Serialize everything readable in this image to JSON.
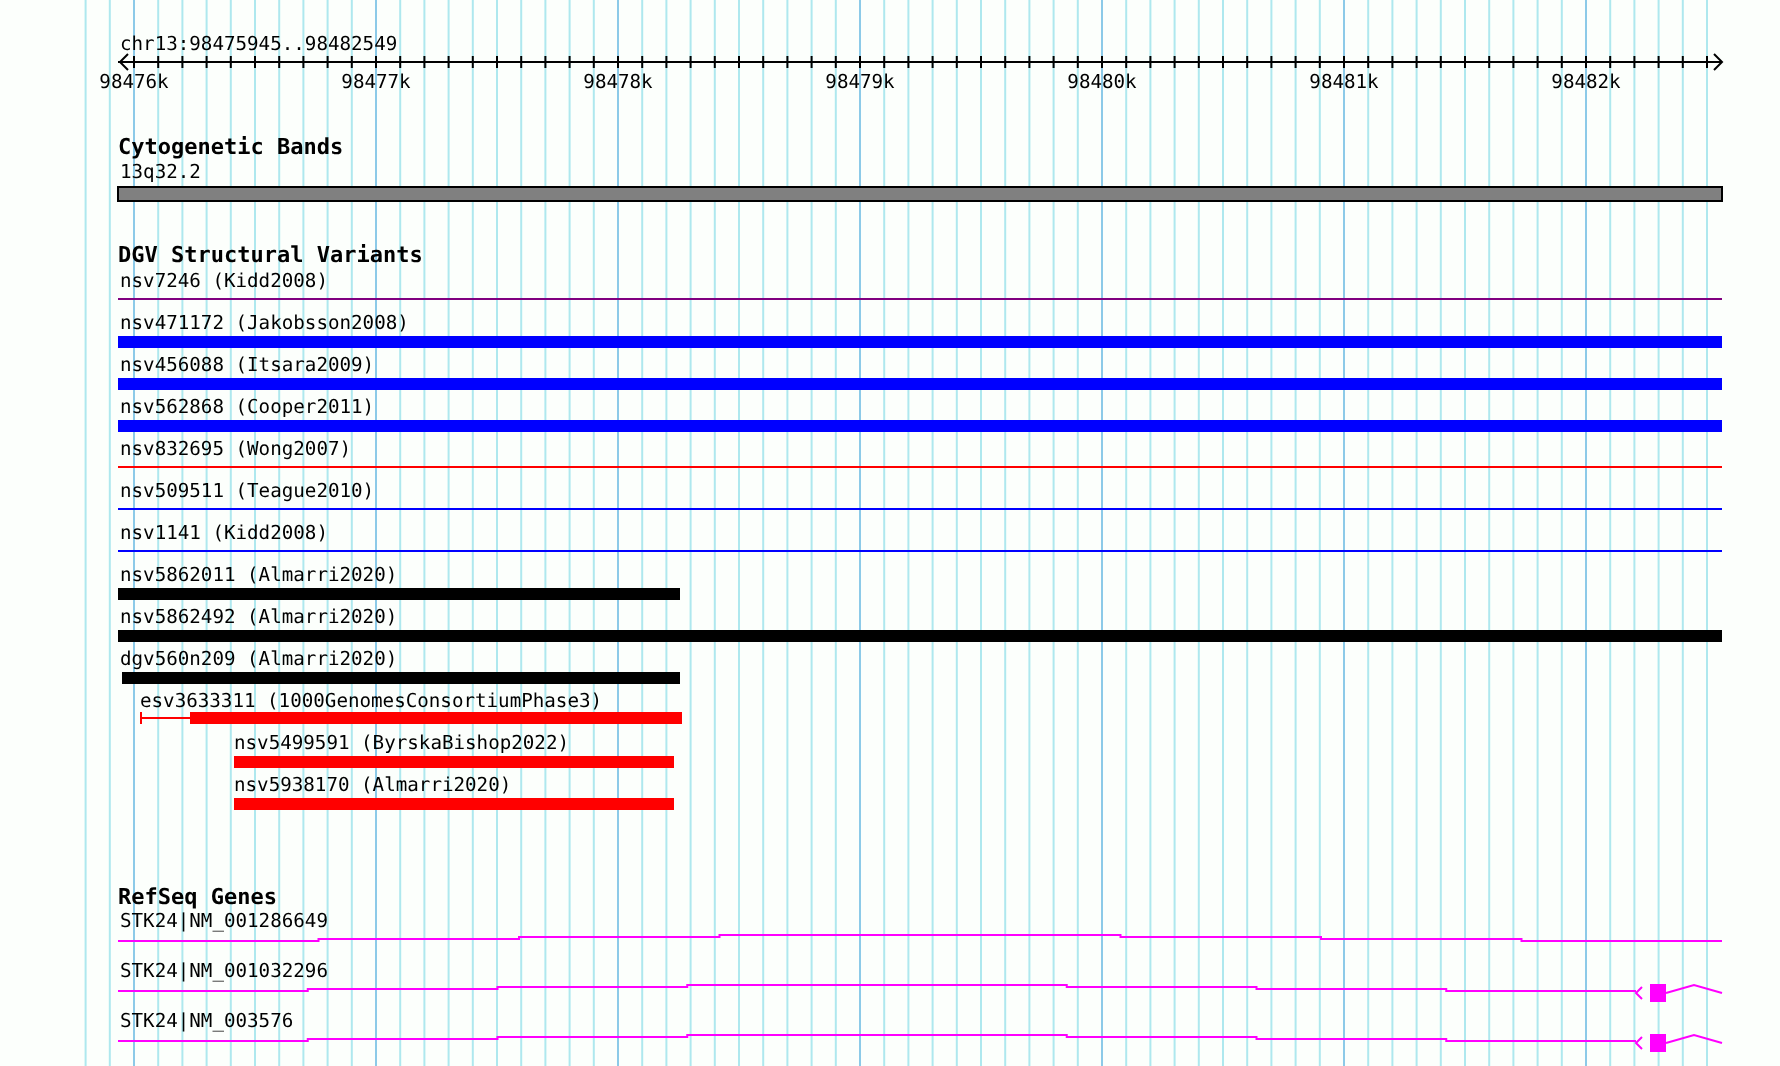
{
  "location": "chr13:98475945..98482549",
  "ruler": {
    "ticks": [
      "98476k",
      "98477k",
      "98478k",
      "98479k",
      "98480k",
      "98481k",
      "98482k"
    ]
  },
  "tracks": [
    {
      "kind": "bands",
      "title": "Cytogenetic Bands",
      "features": [
        {
          "label": "13q32.2"
        }
      ]
    },
    {
      "kind": "variants",
      "title": "DGV Structural Variants",
      "features": [
        {
          "label": "nsv7246 (Kidd2008)",
          "kind": "thin",
          "color": "#800080"
        },
        {
          "label": "nsv471172 (Jakobsson2008)",
          "kind": "thick",
          "color": "#0000ff"
        },
        {
          "label": "nsv456088 (Itsara2009)",
          "kind": "thick",
          "color": "#0000ff"
        },
        {
          "label": "nsv562868 (Cooper2011)",
          "kind": "thick",
          "color": "#0000ff"
        },
        {
          "label": "nsv832695 (Wong2007)",
          "kind": "thin",
          "color": "#ff0000"
        },
        {
          "label": "nsv509511 (Teague2010)",
          "kind": "thin",
          "color": "#0000ff"
        },
        {
          "label": "nsv1141 (Kidd2008)",
          "kind": "thin",
          "color": "#0000ff"
        },
        {
          "label": "nsv5862011 (Almarri2020)",
          "kind": "thick",
          "color": "#000000"
        },
        {
          "label": "nsv5862492 (Almarri2020)",
          "kind": "thick",
          "color": "#000000"
        },
        {
          "label": "dgv560n209 (Almarri2020)",
          "kind": "thick",
          "color": "#000000"
        },
        {
          "label": "esv3633311 (1000GenomesConsortiumPhase3)",
          "kind": "split",
          "color": "#ff0000"
        },
        {
          "label": "nsv5499591 (ByrskaBishop2022)",
          "kind": "thick",
          "color": "#ff0000"
        },
        {
          "label": "nsv5938170 (Almarri2020)",
          "kind": "thick",
          "color": "#ff0000"
        }
      ]
    },
    {
      "kind": "genes",
      "title": "RefSeq Genes",
      "features": [
        {
          "label": "STK24|NM_001286649",
          "kind": "noncoding"
        },
        {
          "label": "STK24|NM_001032296",
          "kind": "coding"
        },
        {
          "label": "STK24|NM_003576",
          "kind": "coding"
        }
      ]
    }
  ]
}
